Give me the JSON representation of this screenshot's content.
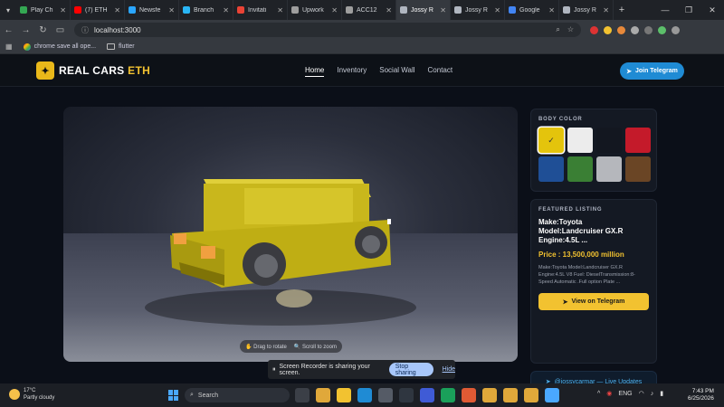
{
  "browser": {
    "tabs": [
      {
        "label": "Play Ch",
        "color": "#34a853"
      },
      {
        "label": "(7) ETH",
        "color": "#ff0000"
      },
      {
        "label": "Newsfe",
        "color": "#2aa6ff"
      },
      {
        "label": "Branch",
        "color": "#29b6f6"
      },
      {
        "label": "Invitati",
        "color": "#ea4335"
      },
      {
        "label": "Upwork",
        "color": "#9e9e9e"
      },
      {
        "label": "ACC12",
        "color": "#9e9e9e"
      },
      {
        "label": "Jossy R",
        "color": "#b0b6c0",
        "active": true
      },
      {
        "label": "Jossy R",
        "color": "#b0b6c0"
      },
      {
        "label": "Google",
        "color": "#4285f4"
      },
      {
        "label": "Jossy R",
        "color": "#b0b6c0"
      }
    ],
    "url": "localhost:3000",
    "bookmarks": [
      {
        "label": "chrome save all ope...",
        "icon": "chrome-icon"
      },
      {
        "label": "flutter",
        "icon": "folder-icon"
      }
    ]
  },
  "site": {
    "logo": {
      "text": "REAL CARS",
      "accent": "ETH"
    },
    "nav": [
      "Home",
      "Inventory",
      "Social Wall",
      "Contact"
    ],
    "telegram_button": "Join Telegram",
    "viewer": {
      "hint_drag": "Drag to rotate",
      "hint_scroll": "Scroll to zoom"
    },
    "body_color": {
      "label": "BODY COLOR",
      "swatches": [
        "#e4c40c",
        "#ececec",
        "#131720",
        "#c41a2a",
        "#1f4f96",
        "#3a7f34",
        "#b5b7bc",
        "#6a4525"
      ],
      "selected": 0
    },
    "featured": {
      "label": "FEATURED LISTING",
      "title": "Make:Toyota Model:Landcruiser GX.R Engine:4.5L ...",
      "price": "Price : 13,500,000 million",
      "description": "Make:Toyota Model:Landcruiser GX.R Engine:4.5L V8 Fuel: DieselTransmission:8-Speed Automatic .Full option Plate ...",
      "button": "View on Telegram"
    },
    "live_updates": "@jossycarmar — Live Updates"
  },
  "recorder": {
    "message": "Screen Recorder is sharing your screen.",
    "stop": "Stop sharing",
    "hide": "Hide"
  },
  "taskbar": {
    "weather_temp": "17°C",
    "weather_desc": "Partly cloudy",
    "search": "Search",
    "lang": "ENG",
    "time": "7:43 PM",
    "date": "6/25/2026"
  }
}
